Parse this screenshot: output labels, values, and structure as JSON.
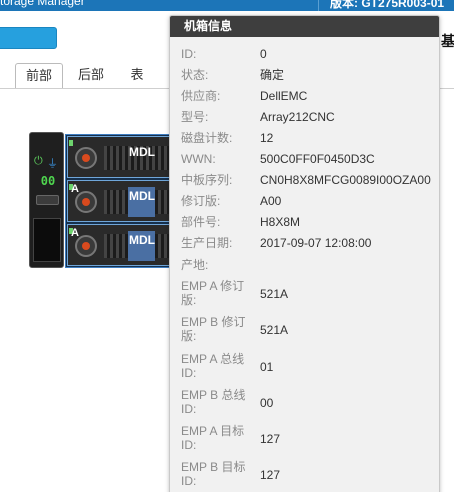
{
  "topbar": {
    "title": "torage Manager",
    "version": "版本: GT275R003-01"
  },
  "header": {
    "right_glyph": "基"
  },
  "tabs": [
    "前部",
    "后部",
    "表"
  ],
  "chassis": {
    "id_display": "00",
    "bays": [
      {
        "letter": "",
        "label": "MDL"
      },
      {
        "letter": "A",
        "label": "MDL"
      },
      {
        "letter": "A",
        "label": "MDL"
      }
    ]
  },
  "popup": {
    "title": "机箱信息",
    "rows": [
      {
        "key": "ID:",
        "value": "0"
      },
      {
        "key": "状态:",
        "value": "确定"
      },
      {
        "key": "供应商:",
        "value": "DellEMC"
      },
      {
        "key": "型号:",
        "value": "Array212CNC"
      },
      {
        "key": "磁盘计数:",
        "value": "12"
      },
      {
        "key": "WWN:",
        "value": "500C0FF0F0450D3C"
      },
      {
        "key": "中板序列:",
        "value": "CN0H8X8MFCG0089I00OZA00"
      },
      {
        "key": "修订版:",
        "value": "A00"
      },
      {
        "key": "部件号:",
        "value": "H8X8M"
      },
      {
        "key": "生产日期:",
        "value": "2017-09-07 12:08:00"
      },
      {
        "key": "产地:",
        "value": ""
      },
      {
        "key": "EMP A 修订版:",
        "value": "521A"
      },
      {
        "key": "EMP B 修订版:",
        "value": "521A"
      },
      {
        "key": "EMP A 总线 ID:",
        "value": "01"
      },
      {
        "key": "EMP B 总线 ID:",
        "value": "00"
      },
      {
        "key": "EMP A 目标 ID:",
        "value": "127"
      },
      {
        "key": "EMP B 目标 ID:",
        "value": "127"
      }
    ]
  }
}
